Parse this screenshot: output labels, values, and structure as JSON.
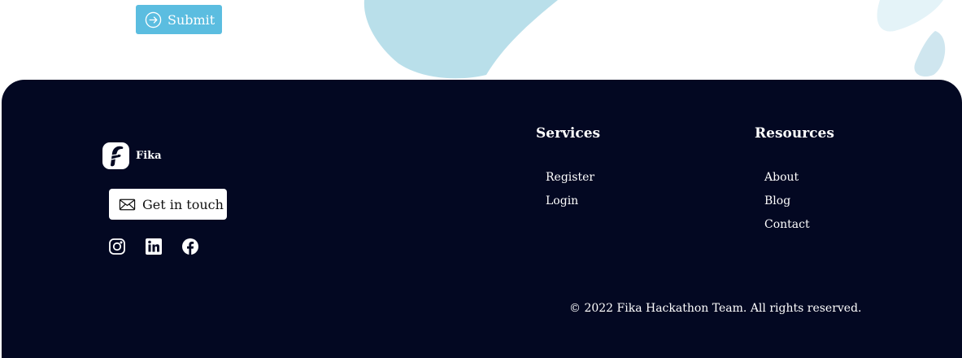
{
  "form": {
    "submit_label": "Submit"
  },
  "footer": {
    "brand_name": "Fika",
    "contact_label": "Get in touch",
    "social_icons": [
      "instagram-icon",
      "linkedin-icon",
      "facebook-icon"
    ],
    "services": {
      "title": "Services",
      "links": [
        "Register",
        "Login"
      ]
    },
    "resources": {
      "title": "Resources",
      "links": [
        "About",
        "Blog",
        "Contact"
      ]
    },
    "copyright": "© 2022 Fika Hackathon Team. All rights reserved."
  },
  "colors": {
    "footer_bg": "#030822",
    "accent": "#5bbde0",
    "blob": "#b9dfea",
    "text_light": "#ffffff"
  }
}
